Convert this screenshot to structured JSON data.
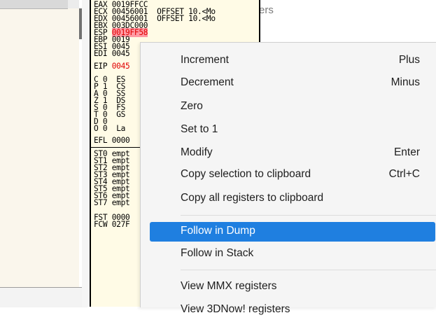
{
  "background": {
    "label": "ers"
  },
  "registers": {
    "gp": [
      {
        "name": "EAX",
        "value": "0019FFCC",
        "comment": ""
      },
      {
        "name": "ECX",
        "value": "00456001",
        "comment": "OFFSET 10.<Mo"
      },
      {
        "name": "EDX",
        "value": "00456001",
        "comment": "OFFSET 10.<Mo"
      },
      {
        "name": "EBX",
        "value": "003DC000",
        "comment": ""
      },
      {
        "name": "ESP",
        "value": "0019FF58",
        "comment": ""
      },
      {
        "name": "EBP",
        "value": "0019",
        "comment": ""
      },
      {
        "name": "ESI",
        "value": "0045",
        "comment": ""
      },
      {
        "name": "EDI",
        "value": "0045",
        "comment": ""
      }
    ],
    "eip": {
      "name": "EIP",
      "value": "0045"
    },
    "flags": [
      {
        "flag": "C",
        "val": "0",
        "seg": "ES"
      },
      {
        "flag": "P",
        "val": "1",
        "seg": "CS"
      },
      {
        "flag": "A",
        "val": "0",
        "seg": "SS"
      },
      {
        "flag": "Z",
        "val": "1",
        "seg": "DS"
      },
      {
        "flag": "S",
        "val": "0",
        "seg": "FS"
      },
      {
        "flag": "T",
        "val": "0",
        "seg": "GS"
      },
      {
        "flag": "D",
        "val": "0",
        "seg": ""
      },
      {
        "flag": "O",
        "val": "0",
        "seg": "La"
      }
    ],
    "efl": {
      "name": "EFL",
      "value": "0000"
    },
    "fpu": [
      {
        "name": "ST0",
        "value": "empt"
      },
      {
        "name": "ST1",
        "value": "empt"
      },
      {
        "name": "ST2",
        "value": "empt"
      },
      {
        "name": "ST3",
        "value": "empt"
      },
      {
        "name": "ST4",
        "value": "empt"
      },
      {
        "name": "ST5",
        "value": "empt"
      },
      {
        "name": "ST6",
        "value": "empt"
      },
      {
        "name": "ST7",
        "value": "empt"
      }
    ],
    "fst": [
      {
        "name": "FST",
        "value": "0000"
      },
      {
        "name": "FCW",
        "value": "027F"
      }
    ]
  },
  "menu": {
    "items": [
      {
        "label": "Increment",
        "shortcut": "Plus"
      },
      {
        "label": "Decrement",
        "shortcut": "Minus"
      },
      {
        "label": "Zero",
        "shortcut": ""
      },
      {
        "label": "Set to 1",
        "shortcut": ""
      },
      {
        "label": "Modify",
        "shortcut": "Enter"
      },
      {
        "label": "Copy selection to clipboard",
        "shortcut": "Ctrl+C"
      },
      {
        "label": "Copy all registers to clipboard",
        "shortcut": ""
      },
      {
        "label": "Follow in Dump",
        "shortcut": "",
        "highlighted": true
      },
      {
        "label": "Follow in Stack",
        "shortcut": ""
      },
      {
        "label": "View MMX registers",
        "shortcut": ""
      },
      {
        "label": "View 3DNow! registers",
        "shortcut": ""
      }
    ],
    "highlight_color": "#1f7fe0"
  }
}
